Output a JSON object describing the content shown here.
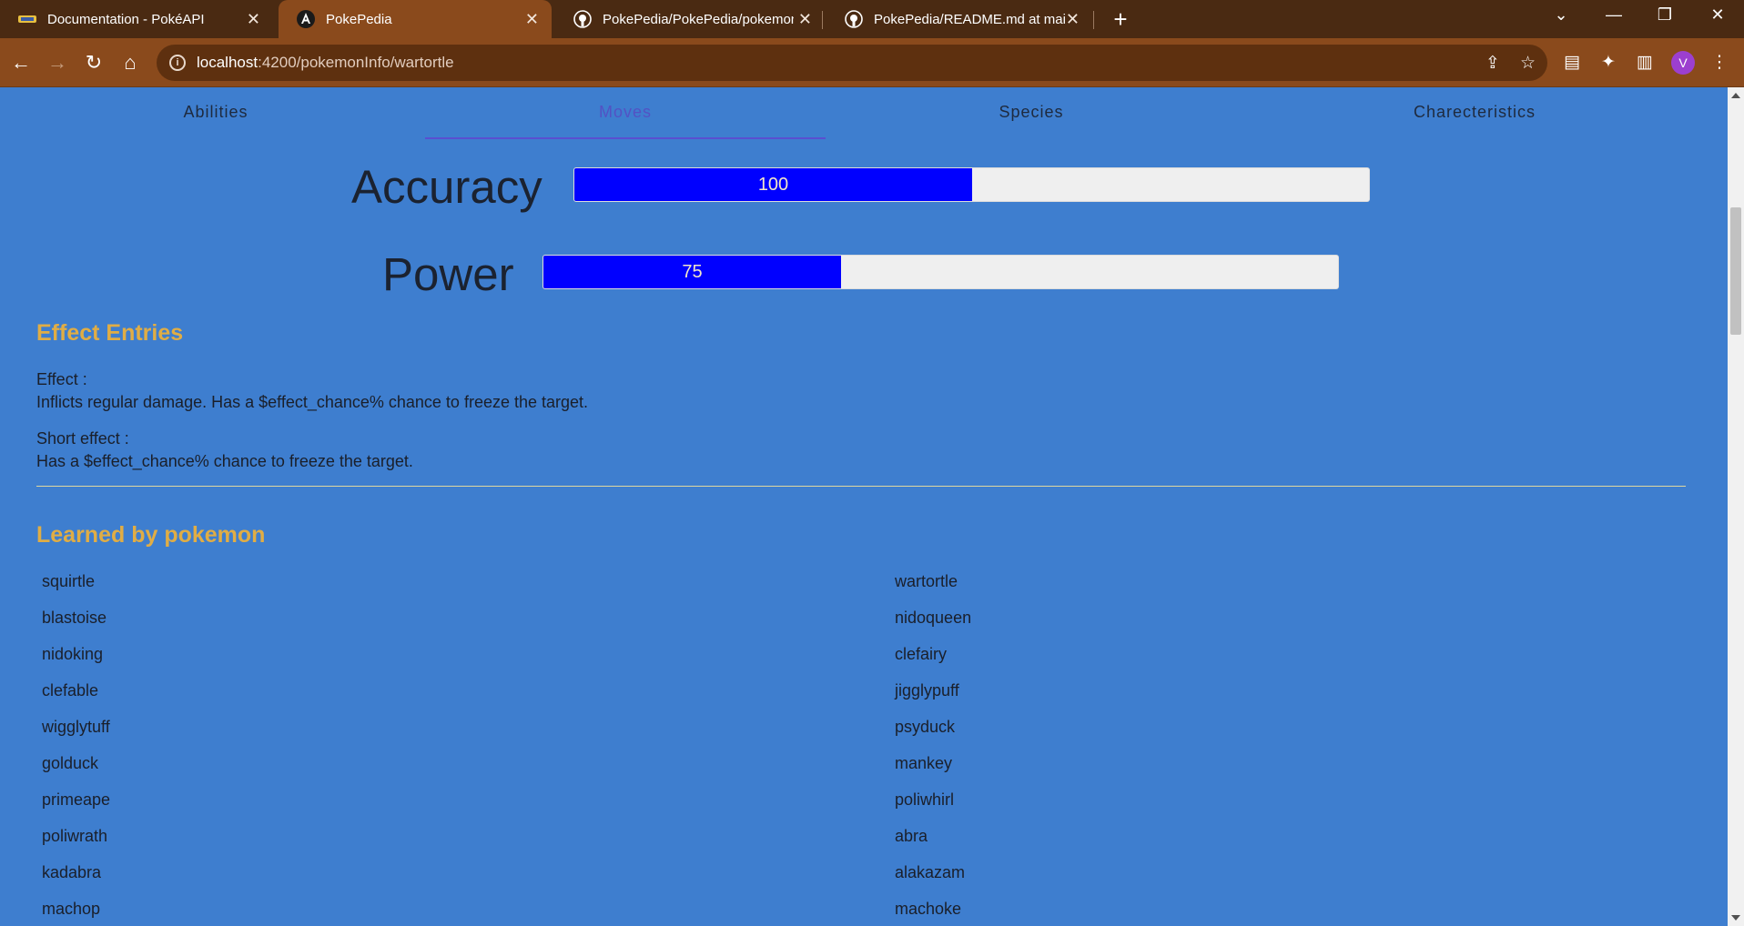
{
  "browser": {
    "tabs": [
      {
        "title": "Documentation - PokéAPI",
        "icon": "pokeapi-logo-icon"
      },
      {
        "title": "PokePedia",
        "icon": "angular-logo-icon"
      },
      {
        "title": "PokePedia/PokePedia/pokemon-",
        "icon": "github-icon"
      },
      {
        "title": "PokePedia/README.md at main",
        "icon": "github-icon"
      }
    ],
    "url_host": "localhost",
    "url_path": ":4200/pokemonInfo/wartortle",
    "profile_initial": "V"
  },
  "nav_tabs": [
    "Abilities",
    "Moves",
    "Species",
    "Charecteristics"
  ],
  "selected_tab": "Moves",
  "stats": {
    "accuracy": {
      "label": "Accuracy",
      "value": "100",
      "fraction": 0.5
    },
    "power": {
      "label": "Power",
      "value": "75",
      "fraction": 0.375
    }
  },
  "effects": {
    "title": "Effect Entries",
    "effect_label": "Effect :",
    "effect_text": "Inflicts regular damage. Has a $effect_chance% chance to freeze the target.",
    "short_label": "Short effect :",
    "short_text": "Has a $effect_chance% chance to freeze the target."
  },
  "learned": {
    "title": "Learned by pokemon",
    "pokemon": [
      "squirtle",
      "wartortle",
      "blastoise",
      "nidoqueen",
      "nidoking",
      "clefairy",
      "clefable",
      "jigglypuff",
      "wigglytuff",
      "psyduck",
      "golduck",
      "mankey",
      "primeape",
      "poliwhirl",
      "poliwrath",
      "abra",
      "kadabra",
      "alakazam",
      "machop",
      "machoke"
    ]
  },
  "colors": {
    "page_bg": "#3e7ecf",
    "accent_title": "#e0ad45",
    "bar_fill": "#0000ff",
    "selected_tab": "#5352c4"
  }
}
